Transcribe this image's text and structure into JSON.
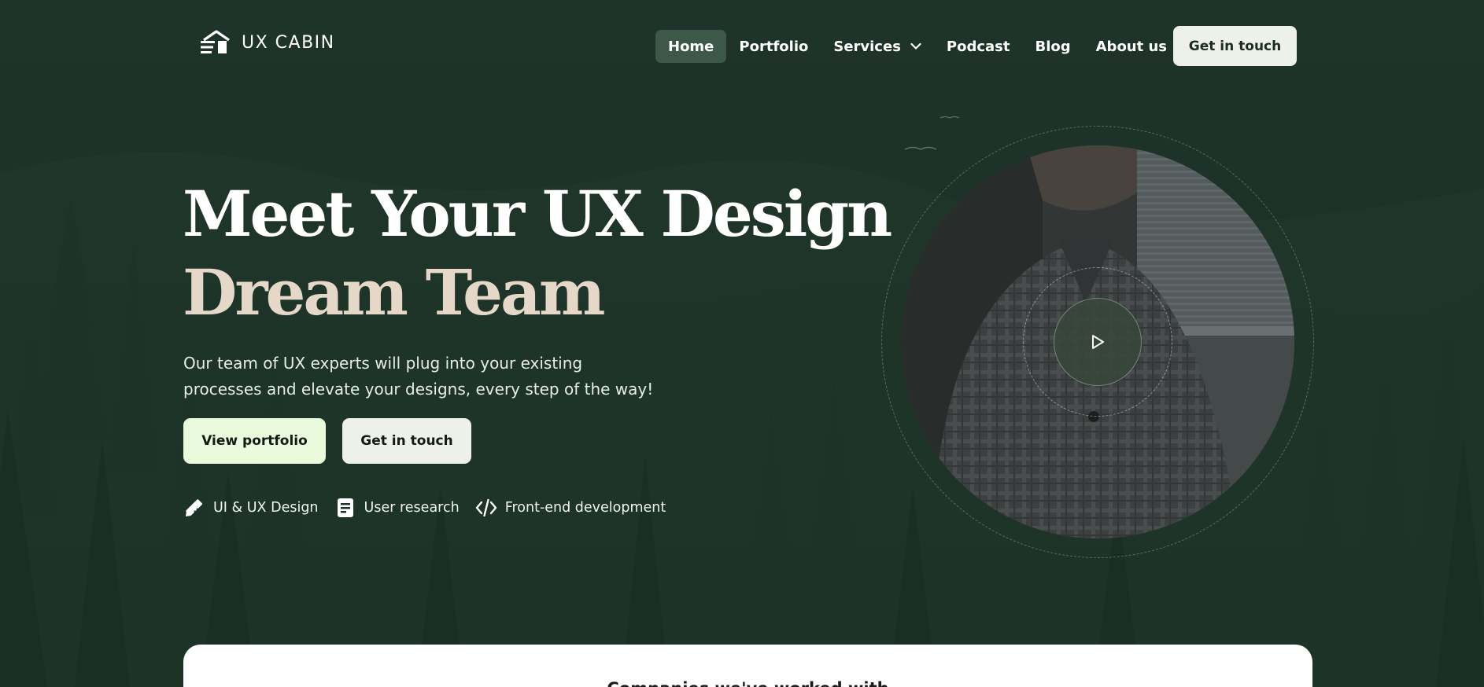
{
  "brand": {
    "name": "UX CABIN",
    "logo_icon": "cabin-logo-icon"
  },
  "nav": {
    "items": [
      {
        "label": "Home",
        "active": true
      },
      {
        "label": "Portfolio",
        "active": false
      },
      {
        "label": "Services",
        "active": false,
        "has_dropdown": true
      },
      {
        "label": "Podcast",
        "active": false
      },
      {
        "label": "Blog",
        "active": false
      },
      {
        "label": "About us",
        "active": false
      }
    ],
    "cta_label": "Get in touch"
  },
  "hero": {
    "headline_line1": "Meet Your UX Design",
    "headline_line2": "Dream Team",
    "subtitle": "Our team of UX experts will plug into your existing processes and elevate your designs, every step of the way!",
    "primary_button": "View portfolio",
    "secondary_button": "Get in touch",
    "features": [
      {
        "icon": "pencil-ruler-icon",
        "label": "UI & UX Design"
      },
      {
        "icon": "document-icon",
        "label": "User research"
      },
      {
        "icon": "code-icon",
        "label": "Front-end development"
      }
    ]
  },
  "video": {
    "play_icon": "play-icon"
  },
  "companies": {
    "title": "Companies we've worked with"
  },
  "colors": {
    "background": "#1c3127",
    "accent_cream": "#e6d8c8",
    "primary_button_bg": "#e9fbdc",
    "secondary_button_bg": "#edf1ea",
    "nav_active_bg": "#3d5848"
  }
}
